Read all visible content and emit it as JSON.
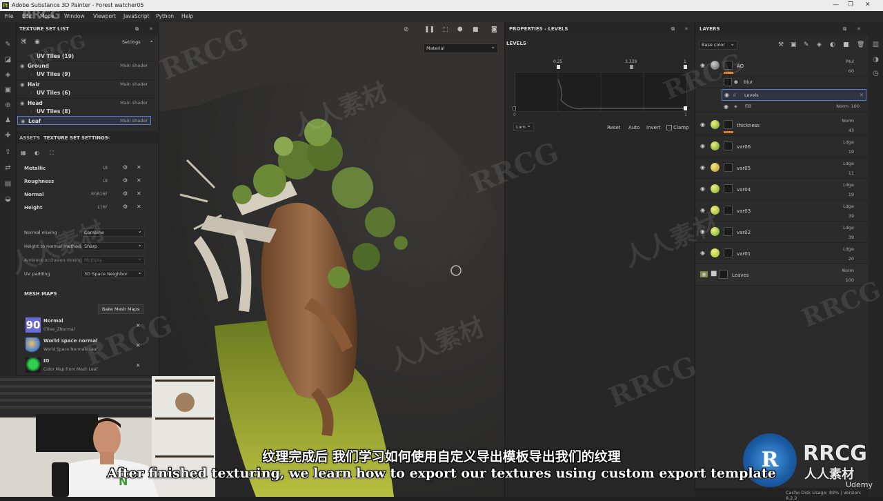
{
  "window": {
    "title": "Adobe Substance 3D Painter - Forest watcher05"
  },
  "menu": [
    "File",
    "Edit",
    "Mode",
    "Window",
    "Viewport",
    "JavaScript",
    "Python",
    "Help"
  ],
  "texture_set_list": {
    "title": "TEXTURE SET LIST",
    "settings_label": "Settings",
    "rows": [
      {
        "name": "UV Tiles (19)",
        "kind": "sub"
      },
      {
        "name": "Ground",
        "shader": "Main shader",
        "kind": "set"
      },
      {
        "name": "UV Tiles (9)",
        "kind": "sub"
      },
      {
        "name": "Hair",
        "shader": "Main shader",
        "kind": "set"
      },
      {
        "name": "UV Tiles (6)",
        "kind": "sub"
      },
      {
        "name": "Head",
        "shader": "Main shader",
        "kind": "set"
      },
      {
        "name": "UV Tiles (8)",
        "kind": "sub"
      },
      {
        "name": "Leaf",
        "shader": "Main shader",
        "kind": "set"
      }
    ]
  },
  "tabs": {
    "assets": "ASSETS",
    "tss": "TEXTURE SET SETTINGS"
  },
  "channels": [
    {
      "name": "Metallic",
      "format": "L8"
    },
    {
      "name": "Roughness",
      "format": "L8"
    },
    {
      "name": "Normal",
      "format": "RGB16F"
    },
    {
      "name": "Height",
      "format": "L16F"
    }
  ],
  "settings": [
    {
      "label": "Normal mixing",
      "value": "Combine"
    },
    {
      "label": "Height to normal method",
      "value": "Sharp"
    },
    {
      "label": "Ambient occlusion mixing",
      "value": "Multiply"
    },
    {
      "label": "UV padding",
      "value": "3D Space Neighbor"
    }
  ],
  "mesh_maps": {
    "title": "MESH MAPS",
    "bake_label": "Bake Mesh Maps",
    "items": [
      {
        "name": "Normal",
        "source": "0Tree_ZNormal",
        "badge": "90"
      },
      {
        "name": "World space normal",
        "source": "World Space Normals Leaf"
      },
      {
        "name": "ID",
        "source": "Color Map from Mesh Leaf"
      }
    ]
  },
  "viewport": {
    "material_select": "Material"
  },
  "properties": {
    "title": "PROPERTIES - LEVELS",
    "section": "LEVELS",
    "val_low": "0.25",
    "val_mid": "3.339",
    "val_high": "1",
    "axis_zero": "0",
    "axis_one": "1",
    "channel_select": "Lum",
    "buttons": [
      "Reset",
      "Auto",
      "Invert"
    ],
    "clamp_label": "Clamp"
  },
  "layers": {
    "title": "LAYERS",
    "channel_select": "Base color",
    "items": [
      {
        "name": "AO",
        "blend": "Mul",
        "opacity": "60",
        "color": "#8a8a8a",
        "bar": "#e07a2a"
      },
      {
        "name": "thickness",
        "blend": "Norm",
        "opacity": "43",
        "color": "#6aa32a",
        "bar": "#e07a2a"
      },
      {
        "name": "var06",
        "blend": "Ldge",
        "opacity": "19",
        "color": "#5e9a2a"
      },
      {
        "name": "var05",
        "blend": "Ldge",
        "opacity": "11",
        "color": "#c08a30"
      },
      {
        "name": "var04",
        "blend": "Ldge",
        "opacity": "19",
        "color": "#7aa82a"
      },
      {
        "name": "var03",
        "blend": "Ldge",
        "opacity": "39",
        "color": "#8ab32a"
      },
      {
        "name": "var02",
        "blend": "Ldge",
        "opacity": "39",
        "color": "#6aa32a"
      },
      {
        "name": "var01",
        "blend": "Ldge",
        "opacity": "20",
        "color": "#9ac02a"
      },
      {
        "name": "Leaves",
        "blend": "Norm",
        "opacity": "100",
        "kind": "folder"
      }
    ],
    "effects": [
      {
        "name": "Blur"
      },
      {
        "name": "Levels"
      },
      {
        "name": "Fill",
        "blend": "Norm",
        "opacity": "100"
      }
    ]
  },
  "subtitles": {
    "cn": "纹理完成后 我们学习如何使用自定义导出模板导出我们的纹理",
    "en": "After finished texturing, we learn how to export our textures using custom export template"
  },
  "status": {
    "cache": "Cache Disk Usage:   89%  |  Version: 8.2.2"
  },
  "watermarks": {
    "brand": "RRCG",
    "cn": "人人素材",
    "udemy": "Udemy"
  }
}
